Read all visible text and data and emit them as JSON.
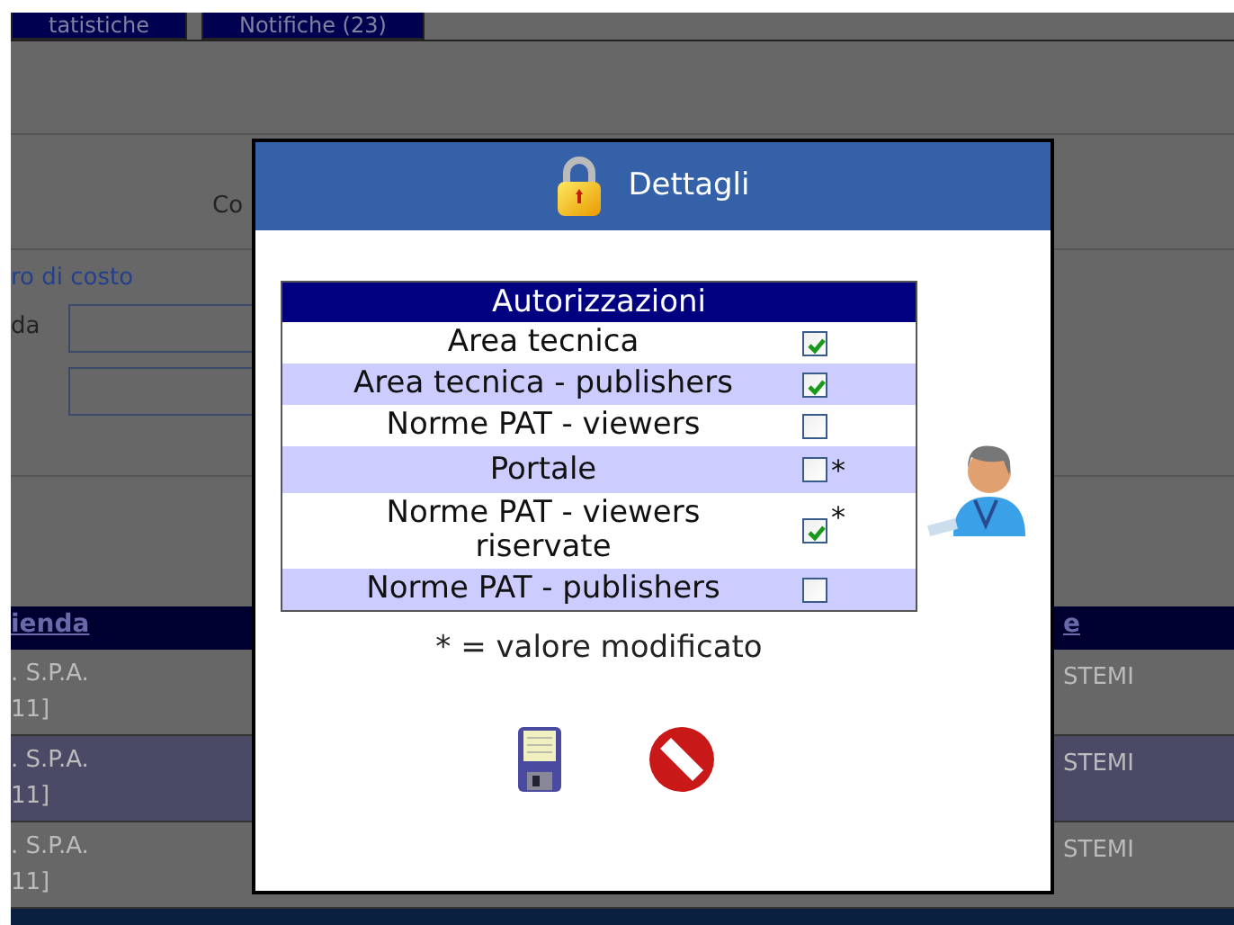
{
  "background": {
    "tabs": [
      {
        "label": "tatistiche"
      },
      {
        "label": "Notifiche (23)"
      }
    ],
    "form": {
      "label": "Co",
      "fieldset_legend": "ro di costo",
      "field_label": "da"
    },
    "table": {
      "columns": [
        "ienda",
        "e"
      ],
      "rows": [
        {
          "column_1": [
            ". S.P.A.",
            "11]"
          ],
          "column_2": "STEMI",
          "selected": false
        },
        {
          "column_1": [
            ". S.P.A.",
            "11]"
          ],
          "column_2": "STEMI",
          "selected": true
        },
        {
          "column_1": [
            ". S.P.A.",
            "11]"
          ],
          "column_2": "STEMI",
          "selected": false
        }
      ]
    }
  },
  "dialog": {
    "title": "Dettagli",
    "table": {
      "title": "Autorizzazioni",
      "rows": [
        {
          "label": "Area tecnica",
          "checked": true
        },
        {
          "label": "Area tecnica - publishers",
          "checked": true
        },
        {
          "label": "Norme PAT - viewers",
          "checked": false
        },
        {
          "label": "Portale",
          "checked": false,
          "modified_mark": "*"
        },
        {
          "label": "Norme PAT - viewers riservate",
          "checked": true,
          "modified_mark": "*"
        },
        {
          "label": "Norme PAT - publishers",
          "checked": false
        }
      ]
    },
    "legend": "* = valore modificato",
    "buttons": [
      {
        "kind": "save"
      },
      {
        "kind": "cancel"
      }
    ]
  }
}
